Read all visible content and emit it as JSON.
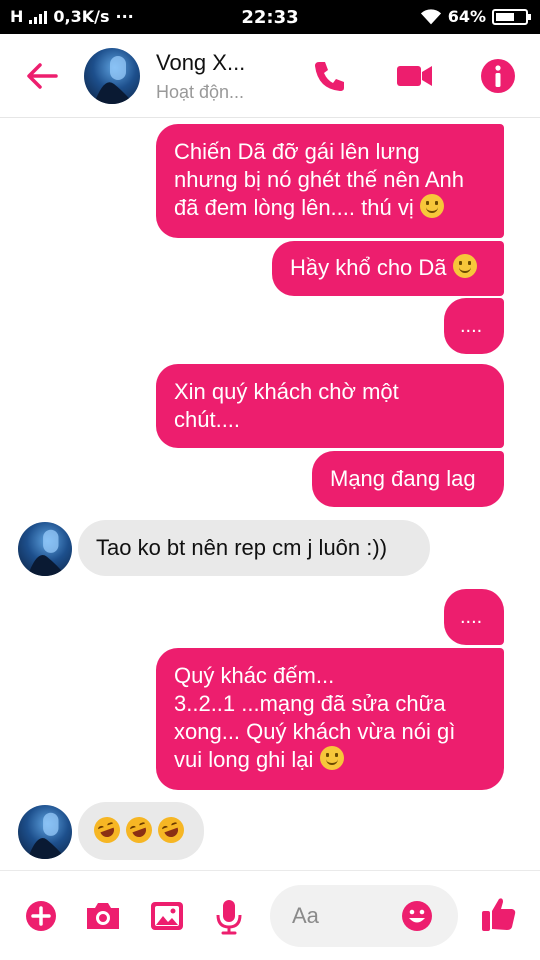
{
  "status_bar": {
    "network": "H",
    "speed": "0,3K/s",
    "dots": "···",
    "time": "22:33",
    "battery_percent": "64%",
    "battery_level": 0.64
  },
  "header": {
    "contact_name": "Vong X...",
    "contact_status": "Hoạt độn..."
  },
  "colors": {
    "accent": "#ed1e6e",
    "incoming_bubble": "#e9e9e9"
  },
  "messages": [
    {
      "dir": "out",
      "lines": [
        "Chiến Dã đỡ gái lên lưng",
        "nhưng bị nó ghét thế nên Anh",
        "đã đem lòng lên.... thú vị"
      ]
    },
    {
      "dir": "out",
      "lines": [
        "Hầy khổ cho Dã"
      ]
    },
    {
      "dir": "out",
      "lines": [
        "...."
      ]
    },
    {
      "dir": "out",
      "lines": [
        "Xin quý khách chờ một",
        "chút...."
      ]
    },
    {
      "dir": "out",
      "lines": [
        "Mạng đang lag"
      ]
    },
    {
      "dir": "in",
      "lines": [
        "Tao ko bt nên rep cm j luôn :))"
      ]
    },
    {
      "dir": "out",
      "lines": [
        "...."
      ]
    },
    {
      "dir": "out",
      "lines": [
        "Quý khác đếm...",
        "3..2..1 ...mạng đã sửa chữa",
        "xong... Quý khách vừa nói gì",
        "vui long ghi lại"
      ]
    },
    {
      "dir": "in",
      "emoji_only": true,
      "emojis": [
        "rolling-on-floor-laughing",
        "rolling-on-floor-laughing",
        "rolling-on-floor-laughing"
      ]
    }
  ],
  "composer": {
    "placeholder": "Aa"
  }
}
